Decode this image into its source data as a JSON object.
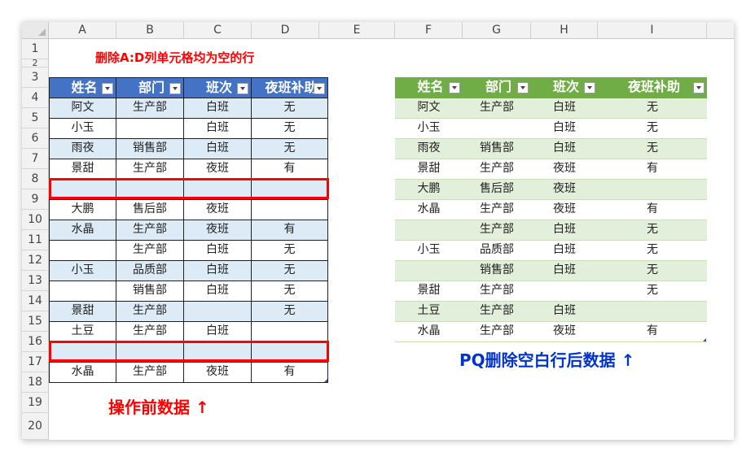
{
  "columns": [
    "A",
    "B",
    "C",
    "D",
    "E",
    "F",
    "G",
    "H",
    "I"
  ],
  "rows": [
    "1",
    "2",
    "3",
    "4",
    "5",
    "6",
    "7",
    "8",
    "9",
    "10",
    "11",
    "12",
    "13",
    "14",
    "15",
    "16",
    "17",
    "18",
    "19",
    "20"
  ],
  "title": "删除A:D列单元格均为空的行",
  "left_caption": "操作前数据 ↑",
  "right_caption": "PQ删除空白行后数据 ↑",
  "colors": {
    "left_header": "#4472c4",
    "left_band": "#ddebf7",
    "right_header": "#70ad47",
    "right_band": "#e2efda",
    "highlight": "#ff0000",
    "caption_blue": "#0033cc"
  },
  "left_table": {
    "headers": [
      "姓名",
      "部门",
      "班次",
      "夜班补助"
    ],
    "rows": [
      [
        "阿文",
        "生产部",
        "白班",
        "无"
      ],
      [
        "小玉",
        "",
        "白班",
        "无"
      ],
      [
        "雨夜",
        "销售部",
        "白班",
        "无"
      ],
      [
        "景甜",
        "生产部",
        "夜班",
        "有"
      ],
      [
        "",
        "",
        "",
        ""
      ],
      [
        "大鹏",
        "售后部",
        "夜班",
        ""
      ],
      [
        "水晶",
        "生产部",
        "夜班",
        "有"
      ],
      [
        "",
        "生产部",
        "白班",
        "无"
      ],
      [
        "小玉",
        "品质部",
        "白班",
        "无"
      ],
      [
        "",
        "销售部",
        "白班",
        "无"
      ],
      [
        "景甜",
        "生产部",
        "",
        "无"
      ],
      [
        "土豆",
        "生产部",
        "白班",
        ""
      ],
      [
        "",
        "",
        "",
        ""
      ],
      [
        "水晶",
        "生产部",
        "夜班",
        "有"
      ]
    ]
  },
  "right_table": {
    "headers": [
      "姓名",
      "部门",
      "班次",
      "夜班补助"
    ],
    "rows": [
      [
        "阿文",
        "生产部",
        "白班",
        "无"
      ],
      [
        "小玉",
        "",
        "白班",
        "无"
      ],
      [
        "雨夜",
        "销售部",
        "白班",
        "无"
      ],
      [
        "景甜",
        "生产部",
        "夜班",
        "有"
      ],
      [
        "大鹏",
        "售后部",
        "夜班",
        ""
      ],
      [
        "水晶",
        "生产部",
        "夜班",
        "有"
      ],
      [
        "",
        "生产部",
        "白班",
        "无"
      ],
      [
        "小玉",
        "品质部",
        "白班",
        "无"
      ],
      [
        "",
        "销售部",
        "白班",
        "无"
      ],
      [
        "景甜",
        "生产部",
        "",
        "无"
      ],
      [
        "土豆",
        "生产部",
        "白班",
        ""
      ],
      [
        "水晶",
        "生产部",
        "夜班",
        "有"
      ]
    ]
  },
  "icons": {
    "filter_dropdown": "filter-dropdown-icon",
    "select_all": "select-all-corner-icon"
  }
}
